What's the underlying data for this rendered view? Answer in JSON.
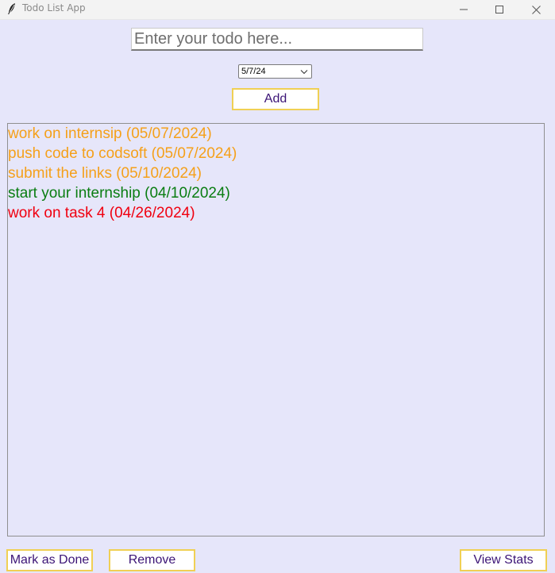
{
  "window": {
    "title": "Todo List App",
    "icon": "feather-quill-icon"
  },
  "form": {
    "todo_placeholder": "Enter your todo here...",
    "todo_value": "",
    "date_value": "5/7/24",
    "add_label": "Add"
  },
  "todos": [
    {
      "text": "work on internsip (05/07/2024)",
      "color": "#f5a01a"
    },
    {
      "text": "push code to codsoft (05/07/2024)",
      "color": "#f5a01a"
    },
    {
      "text": "submit the links (05/10/2024)",
      "color": "#f5a01a"
    },
    {
      "text": "start your internship (04/10/2024)",
      "color": "#0a7d12"
    },
    {
      "text": "work on task 4 (04/26/2024)",
      "color": "#f00010"
    }
  ],
  "actions": {
    "mark_done_label": "Mark as Done",
    "remove_label": "Remove",
    "view_stats_label": "View Stats"
  },
  "colors": {
    "background": "#e6e6fa",
    "button_border": "#f0d054",
    "button_text": "#3b1476"
  }
}
